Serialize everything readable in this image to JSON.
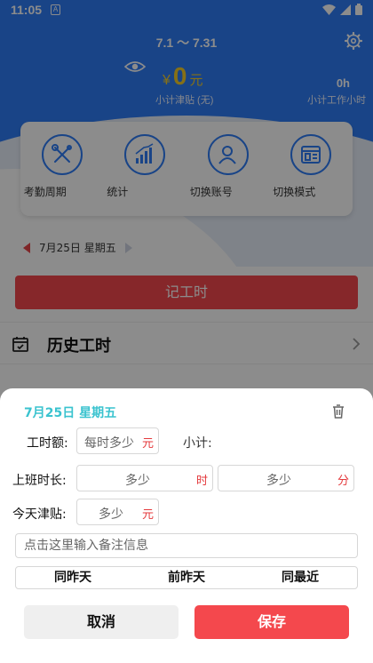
{
  "status_bar": {
    "time": "11:05",
    "notification_letter": "A"
  },
  "header": {
    "period": "7.1 ～ 7.31",
    "currency": "¥",
    "subsidy_amount": "0",
    "subsidy_unit": "元",
    "subsidy_label": "小计津贴 (无)",
    "hours_value": "0h",
    "hours_label": "小计工作小时"
  },
  "quick_actions": [
    {
      "label": "考勤周期",
      "icon": "tools-icon"
    },
    {
      "label": "统计",
      "icon": "bar-chart-icon"
    },
    {
      "label": "切换账号",
      "icon": "users-icon"
    },
    {
      "label": "切换模式",
      "icon": "window-icon"
    }
  ],
  "date_nav": {
    "label": "7月25日 星期五"
  },
  "record_button": "记工时",
  "history": {
    "title": "历史工时"
  },
  "dialog": {
    "date": "7月25日 星期五",
    "quota_label": "工时额:",
    "quota_placeholder": "每时多少",
    "quota_unit": "元",
    "subtotal_label": "小计:",
    "duration_label": "上班时长:",
    "hours_placeholder": "多少",
    "hours_unit": "时",
    "minutes_placeholder": "多少",
    "minutes_unit": "分",
    "subsidy_label": "今天津贴:",
    "subsidy_placeholder": "多少",
    "subsidy_unit": "元",
    "note_placeholder": "点击这里输入备注信息",
    "quick_fill": [
      "同昨天",
      "前昨天",
      "同最近"
    ],
    "cancel": "取消",
    "save": "保存"
  },
  "colors": {
    "primary_blue": "#2f7df6",
    "accent_red": "#f4484d",
    "date_teal": "#3ac3cf",
    "gold": "#f3cd2b"
  }
}
